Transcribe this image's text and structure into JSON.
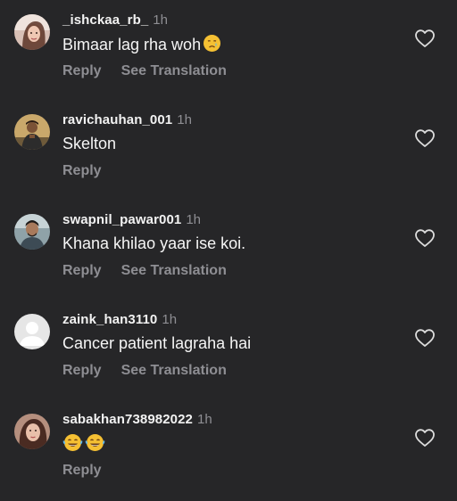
{
  "comments": [
    {
      "username": "_ishckaa_rb_",
      "time": "1h",
      "text": "Bimaar lag rha woh",
      "text_emoji": "crying-face",
      "reply_label": "Reply",
      "translation_label": "See Translation"
    },
    {
      "username": "ravichauhan_001",
      "time": "1h",
      "text": "Skelton",
      "reply_label": "Reply"
    },
    {
      "username": "swapnil_pawar001",
      "time": "1h",
      "text": "Khana khilao yaar ise koi.",
      "reply_label": "Reply",
      "translation_label": "See Translation"
    },
    {
      "username": "zaink_han3110",
      "time": "1h",
      "text": "Cancer patient lagraha hai",
      "reply_label": "Reply",
      "translation_label": "See Translation"
    },
    {
      "username": "sabakhan738982022",
      "time": "1h",
      "text_emoji": "tears-of-joy",
      "reply_label": "Reply"
    }
  ],
  "icons": {
    "like": "heart-outline-icon"
  },
  "colors": {
    "background": "#262628",
    "primary_text": "#f2f2f2",
    "secondary_text": "#8e8e93"
  }
}
